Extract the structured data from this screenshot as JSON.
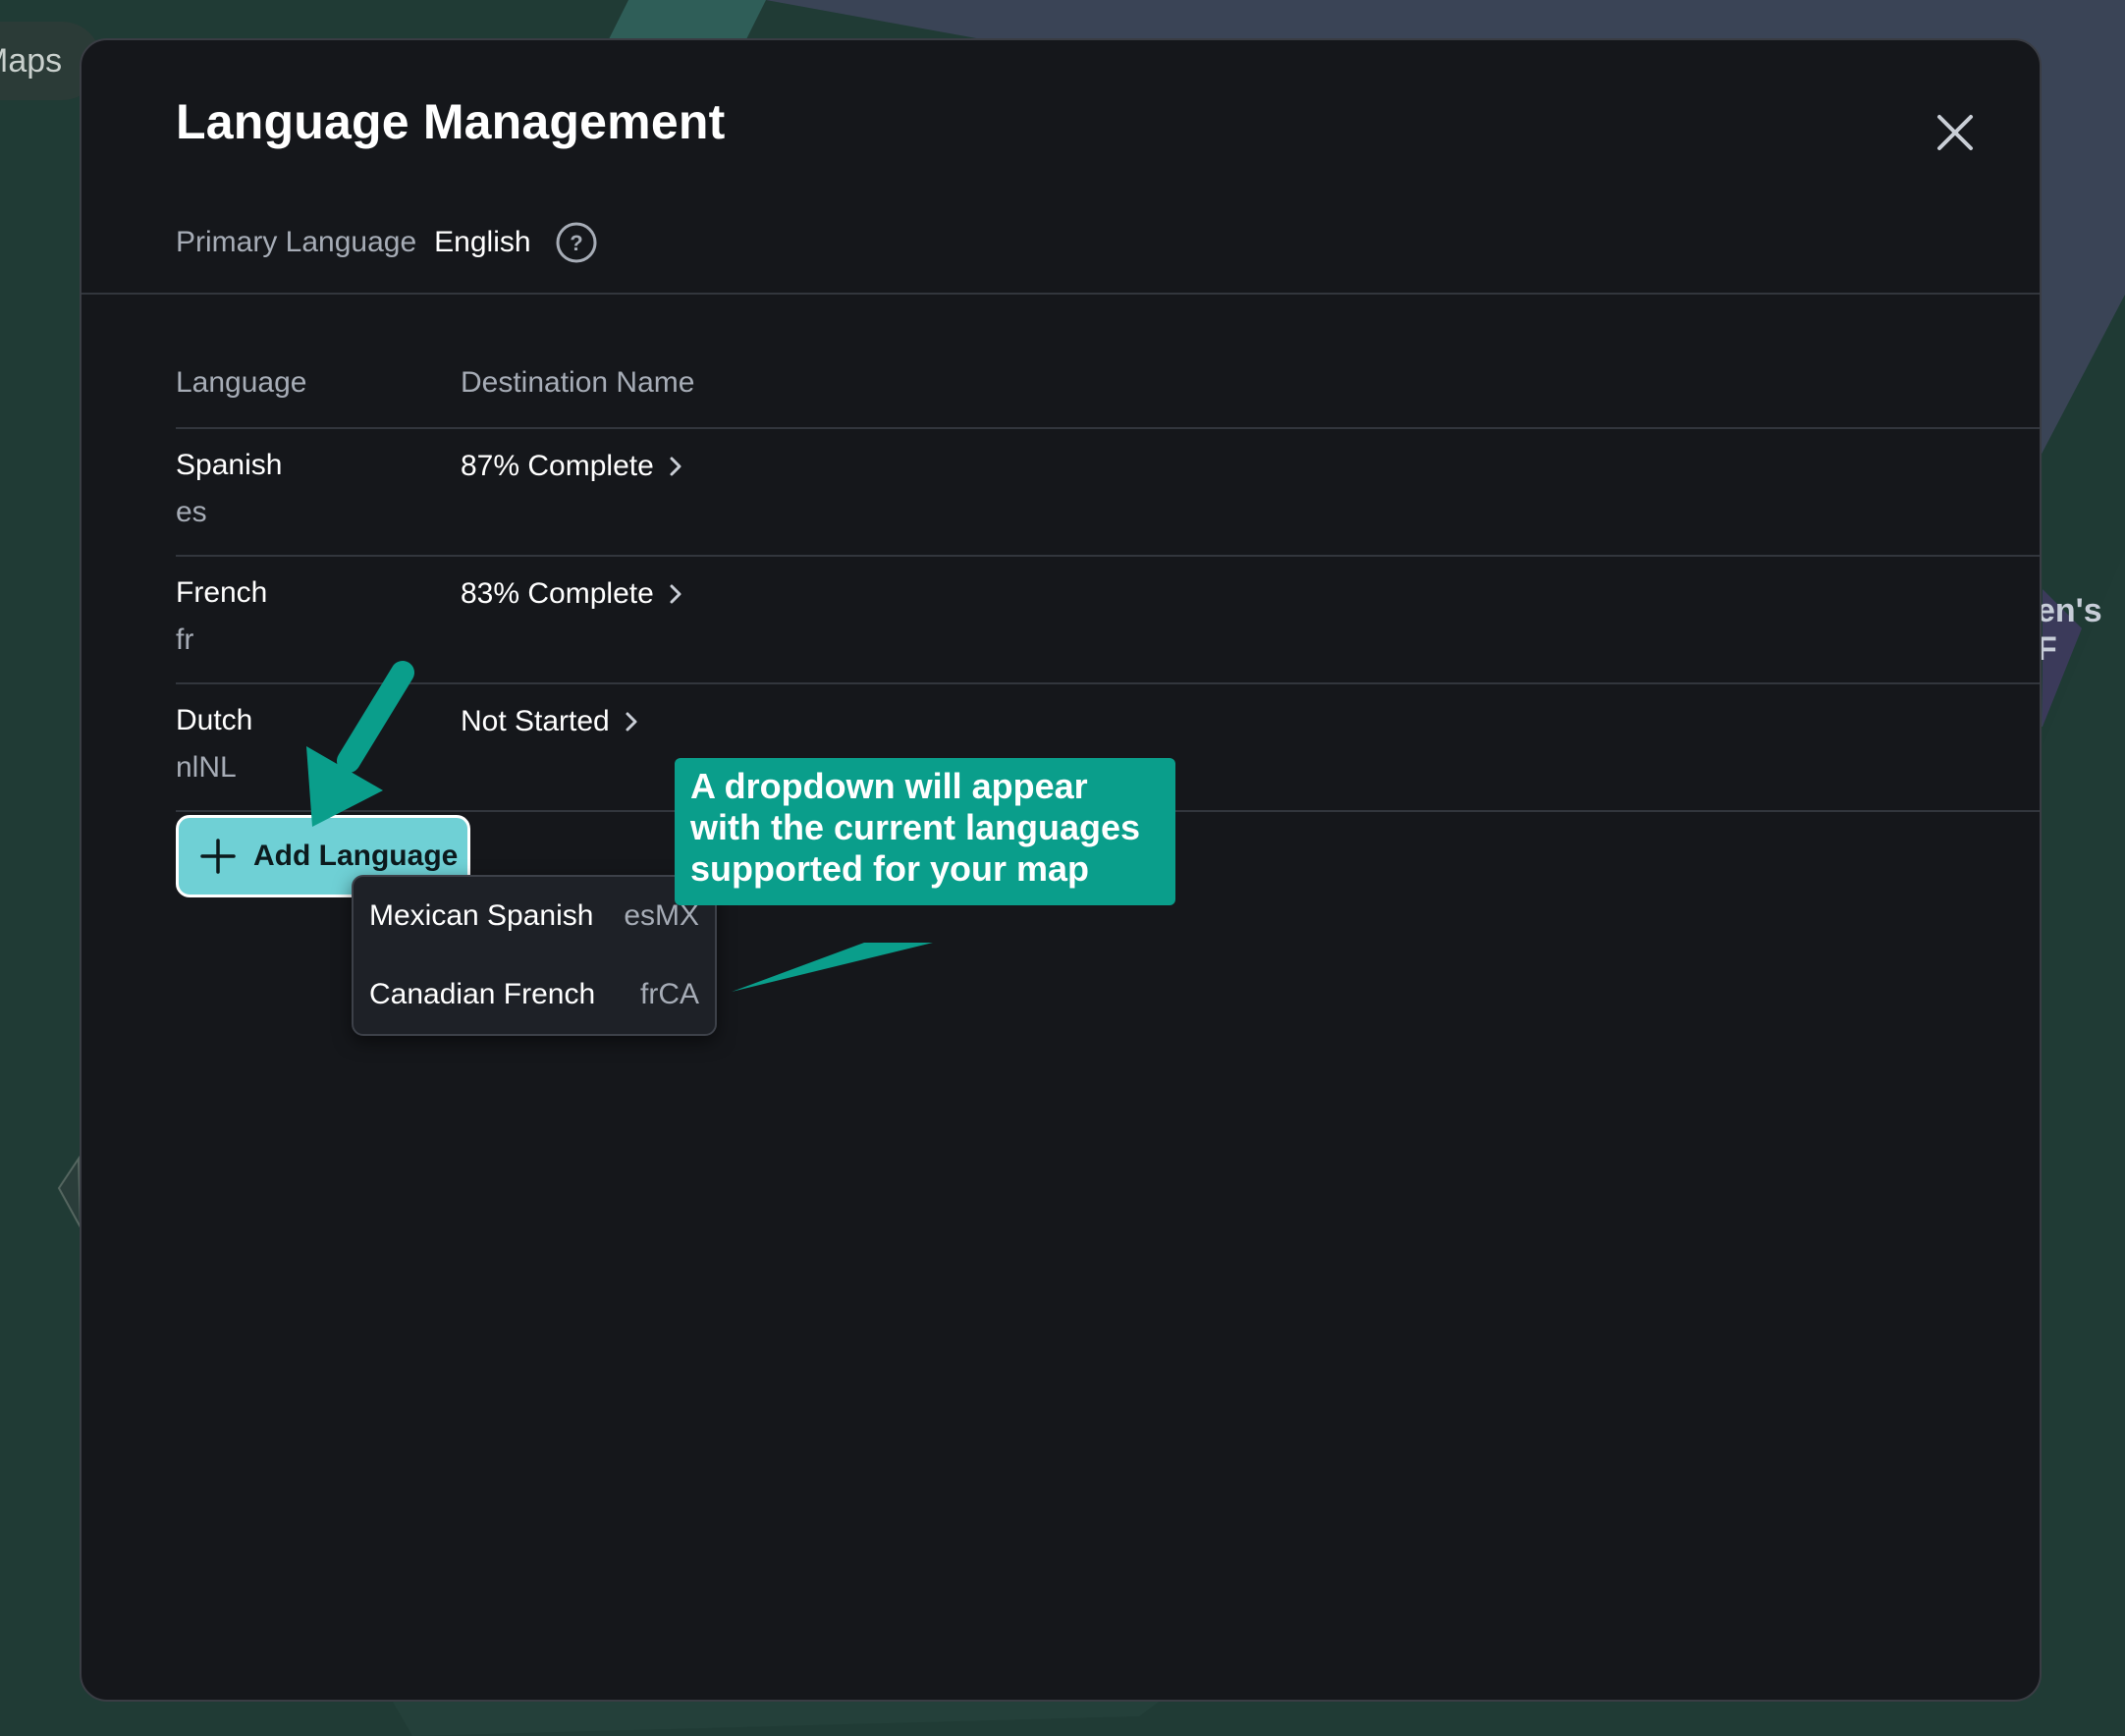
{
  "background": {
    "map_tab_label": "Maps",
    "map_label_right": "en's F"
  },
  "modal": {
    "title": "Language Management",
    "primary_language_label": "Primary Language",
    "primary_language_value": "English",
    "help_icon": "question-circle-icon",
    "close_icon": "close-icon"
  },
  "table": {
    "headers": {
      "language": "Language",
      "destination_name": "Destination Name"
    },
    "rows": [
      {
        "name": "Spanish",
        "code": "es",
        "status": "87% Complete"
      },
      {
        "name": "French",
        "code": "fr",
        "status": "83% Complete"
      },
      {
        "name": "Dutch",
        "code": "nlNL",
        "status": "Not Started"
      }
    ]
  },
  "add_language": {
    "label": "Add Language",
    "icon": "plus-icon"
  },
  "dropdown": {
    "items": [
      {
        "name": "Mexican Spanish",
        "code": "esMX"
      },
      {
        "name": "Canadian French",
        "code": "frCA"
      }
    ]
  },
  "annotation": {
    "callout_text": "A dropdown will appear with the current languages supported for your map",
    "color": "#0a9e8b"
  },
  "colors": {
    "modal_bg": "#15171b",
    "accent_button": "#6fd0d5",
    "annotation": "#0a9e8b"
  }
}
